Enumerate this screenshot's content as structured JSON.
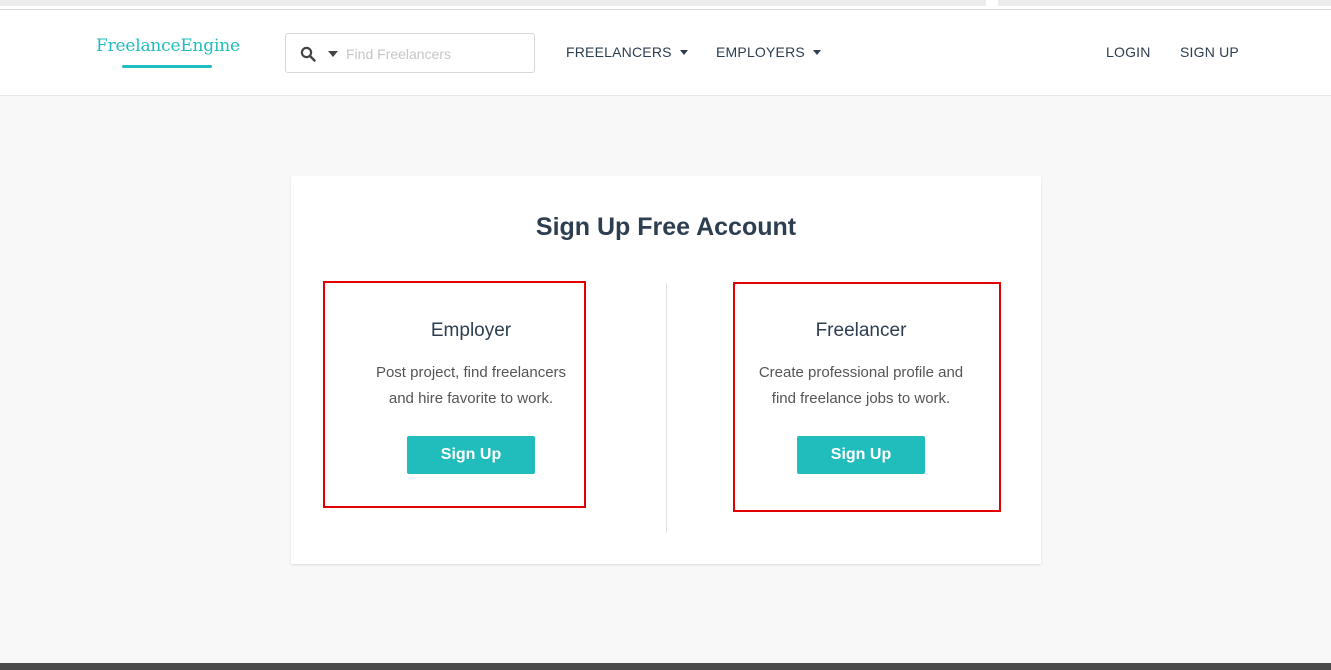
{
  "brand": {
    "logo_text": "FreelanceEngine",
    "accent_color": "#1fbdbd"
  },
  "header": {
    "search": {
      "placeholder": "Find Freelancers",
      "icon": "search-icon"
    },
    "nav": {
      "freelancers": "FREELANCERS",
      "employers": "EMPLOYERS",
      "login": "LOGIN",
      "signup": "SIGN UP"
    }
  },
  "signup_card": {
    "title": "Sign Up Free Account",
    "options": [
      {
        "heading": "Employer",
        "description_line1": "Post project, find freelancers",
        "description_line2": "and hire favorite to work.",
        "button_label": "Sign Up"
      },
      {
        "heading": "Freelancer",
        "description_line1": "Create professional profile and",
        "description_line2": "find freelance jobs to work.",
        "button_label": "Sign Up"
      }
    ]
  },
  "colors": {
    "button": "#21bdbd",
    "highlight_box": "#e30000",
    "text": "#2c3e50"
  }
}
